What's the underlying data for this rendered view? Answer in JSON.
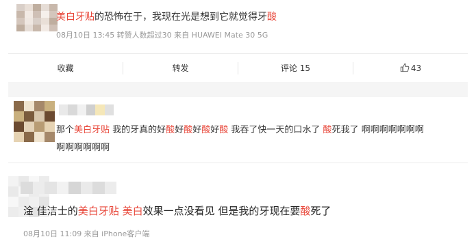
{
  "post": {
    "text_parts": [
      {
        "t": "美白牙贴",
        "hl": true
      },
      {
        "t": "的恐怖在于，我现在光是想到它就觉得牙",
        "hl": false
      },
      {
        "t": "酸",
        "hl": true
      }
    ],
    "meta": "08月10日 13:45 转赞人数超过30  来自 HUAWEI Mate 30 5G"
  },
  "actions": {
    "favorite": "收藏",
    "repost": "转发",
    "comment": "评论 15",
    "like_count": "43"
  },
  "comments": [
    {
      "line1_parts": [
        {
          "t": "那个",
          "hl": false
        },
        {
          "t": "美白牙贴",
          "hl": true
        },
        {
          "t": " 我的牙真的好",
          "hl": false
        },
        {
          "t": "酸",
          "hl": true
        },
        {
          "t": "好",
          "hl": false
        },
        {
          "t": "酸",
          "hl": true
        },
        {
          "t": "好",
          "hl": false
        },
        {
          "t": "酸",
          "hl": true
        },
        {
          "t": "好",
          "hl": false
        },
        {
          "t": "酸",
          "hl": true
        },
        {
          "t": " 我吞了快一天的口水了 ",
          "hl": false
        },
        {
          "t": "酸",
          "hl": true
        },
        {
          "t": "死我了 啊啊啊啊啊啊啊",
          "hl": false
        }
      ],
      "line2": "啊啊啊啊啊啊"
    },
    {
      "text_parts": [
        {
          "t": "淦 佳洁士的",
          "hl": false
        },
        {
          "t": "美白牙贴",
          "hl": true
        },
        {
          "t": " ",
          "hl": false
        },
        {
          "t": "美白",
          "hl": true
        },
        {
          "t": "效果一点没看见 但是我的牙现在要",
          "hl": false
        },
        {
          "t": "酸",
          "hl": true
        },
        {
          "t": "死了",
          "hl": false
        }
      ],
      "meta": "08月10日 11:09  来自 iPhone客户端"
    }
  ],
  "colors": {
    "highlight": "#e8473a",
    "meta": "#999999",
    "divider": "#ececec"
  },
  "icons": {
    "like": "thumbs-up-icon"
  }
}
